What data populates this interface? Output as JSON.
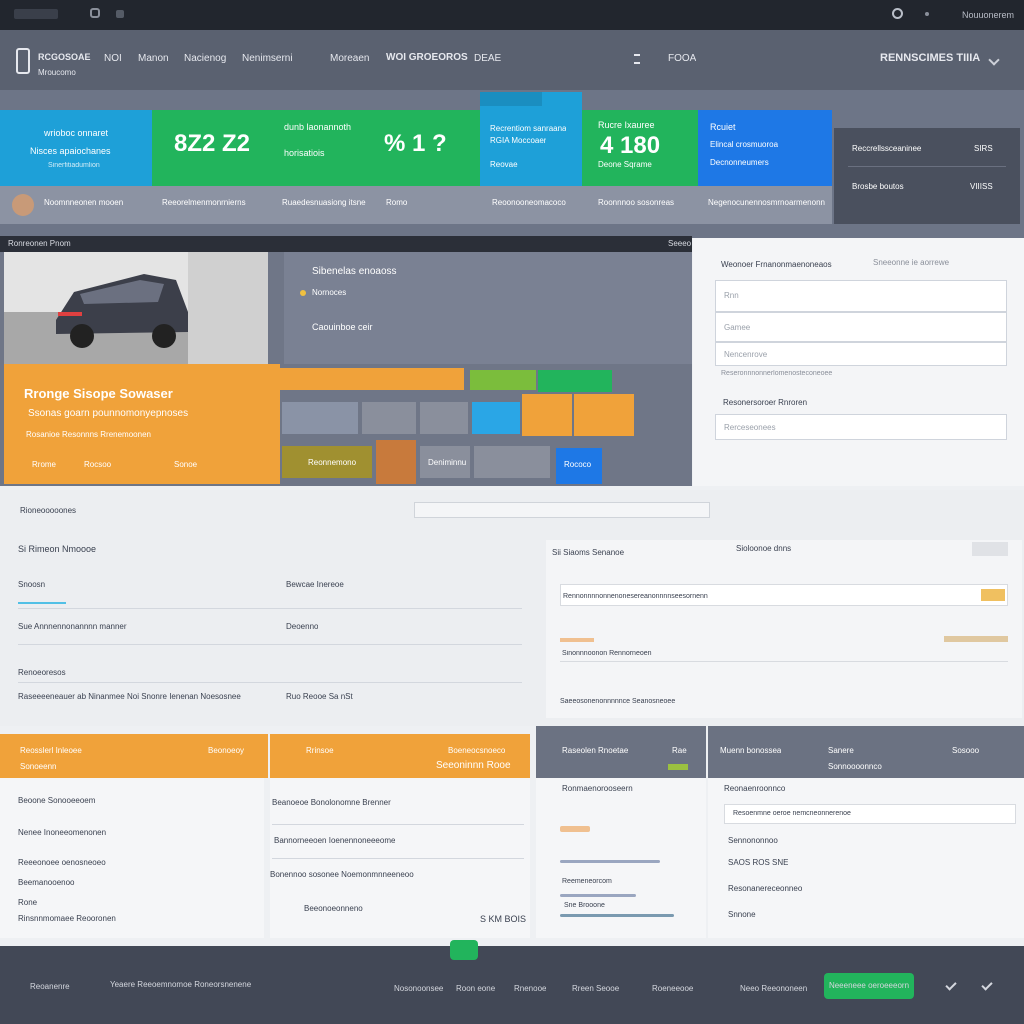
{
  "topbar": {
    "user": "Nouuonerem",
    "icons": [
      "search-icon",
      "notification-dot-icon"
    ]
  },
  "nav": {
    "brand_title": "RCGOSOAE",
    "brand_sub": "Mroucomo",
    "items": [
      "NOI",
      "Manon",
      "Nacienog",
      "Nenimserni",
      "Moreaen"
    ],
    "center_title": "WOI GROEOROS",
    "center_sub": "DEAE",
    "mid_item": "FOOA",
    "right_title": "RENNSCIMES TIIIA",
    "colors": {
      "bg": "#5a6170"
    }
  },
  "stats": [
    {
      "title": "wrioboc onnaret",
      "sub": "Nisces apaiochanes",
      "foot": "Sinerfitiadumlion",
      "color": "#1ea0d8"
    },
    {
      "value": "8Z2 Z2",
      "foot": "",
      "color": "#22b45c"
    },
    {
      "title": "dunb laonannoth",
      "sub": "horisatiois",
      "value": "%  1 ?",
      "color": "#22b45c"
    },
    {
      "title": "Recrentiom sanraana",
      "sub": "RGIA Moccoaer",
      "foot": "Reovae",
      "color": "#1ea0d8"
    },
    {
      "title": "Rucre Ixauree",
      "value": "4 180",
      "foot": "Deone  Sqrame",
      "color": "#22b45c"
    },
    {
      "title": "Rcuiet",
      "sub": "Elincal crosmuoroa",
      "foot": "Decnonneumers",
      "color": "#1e78e6"
    }
  ],
  "stats_side": [
    {
      "label": "Reccrellssceaninee",
      "value": "SIRS"
    },
    {
      "label": "Brosbe boutos",
      "value": "VIIISS"
    }
  ],
  "subrow": [
    "Noomnneonen mooen",
    "Reeorelmenmonrnierns",
    "Ruaedesnuasiong itsne",
    "Romo",
    "Reoonooneomacoco",
    "Roonnnoo sosonreas",
    "Negenocunennosmrnoarmenonn"
  ],
  "media": {
    "header": "Ronreonen Pnom",
    "header_right": "Seeeo",
    "panel_title": "Sibenelas enoaoss",
    "panel_sub": "Nornoces",
    "panel_badge": "Caouinboe ceir",
    "promo_title": "Rronge Sisope Sowaser",
    "promo_sub": "Ssonas goarn pounnomonyepnoses",
    "promo_meta": "Rosanioe Resonnns Rrenemoonen",
    "promo_buttons": [
      "Rrome",
      "Rocsoo",
      "Sonoe"
    ],
    "tiles": [
      "Reonnemono",
      "Deniminnu",
      "Rococo"
    ]
  },
  "rform": {
    "title": "Weonoer Frnanonmaenoneaos",
    "link": "Sneeonne ie aorrewe",
    "fields": [
      "Rnn",
      "Gamee",
      "Nencenrove",
      "Reseronnnonnerlomenosteconeoee"
    ],
    "label2": "Resonersoroer Rnroren",
    "field_last": "Rerceseonees"
  },
  "mid": {
    "title": "Rioneooooones",
    "left_heading": "Si Rimeon Nmoooe",
    "col1_head": "Snoosn",
    "col2_head": "Bewcae Inereoe",
    "rows_left": [
      "Sue Annnennonannnn manner",
      "Renoeoresos",
      "Raseeeeneauer ab Ninanmee  Noi Snonre Ienenan Noesosnee"
    ],
    "rows_left2": [
      "Deoenno",
      "Ruo Reooe Sa  nSt"
    ],
    "right_heading": "Sii  Siaoms Senanoe",
    "right_aside": "Sioloonoe dnns",
    "rows_right": [
      "Rennonnnnonnenonesereanonnnnseesornenn",
      "Sinonnnoonon Rennorneoen",
      "Saeeosonenonnnnnce Seanosneoee"
    ]
  },
  "panels": [
    {
      "title": "Reosslerl Inleoee",
      "aside": "Beonoeoy",
      "sub": "Sonoeenn",
      "rows": [
        "Beoone Sonooeeoem",
        "Nenee Inoneeomenonen",
        "Reeeonoee oenosneoeo",
        "Beemanooenoo",
        "Rone",
        "Rinsnnmomaee Reooronen"
      ]
    },
    {
      "title": "Rrinsoe",
      "aside": "Boeneocsnoeco",
      "aside2": "Seeoninnn Rooe",
      "rows": [
        "Beanoeoe Bonolonomne Brenner",
        "Bannorneeoen Ioenennoneeeome",
        "Bonennoo sosonee Noemonmnneeneoo",
        "Beeonoeonneno"
      ],
      "foot": "S KM BOIS"
    },
    {
      "title": "Raseolen Rnoetae",
      "aside": "Rae",
      "sub": "Ronmaenorooseern",
      "rows": [
        "Reemeneorcom",
        "Sne  Brooone",
        "Snooonenae"
      ]
    },
    {
      "title": "Muenn bonossea",
      "aside": "Sanere",
      "aside2": "Sosooo",
      "sub": "Sonnoooonnco",
      "rows": [
        "Reonaenroonnco",
        "Resoenmne oeroe nemcneonnerenoe",
        "Sennononnoo",
        "SAOS ROS SNE",
        "Resonanereceonneo",
        "Snnone"
      ]
    }
  ],
  "footer": {
    "items": [
      "Reoanenre",
      "Yeaere Reeoemnomoe Roneorsnenene",
      "Nosonoonsee",
      "Roon eone",
      "Rnenooe",
      "Rreen Seooe",
      "Roeneeooe",
      "Neeo Reeononeen"
    ],
    "cta": "Neeeneee oeroeeeorn",
    "icons": [
      "check-icon",
      "check-icon"
    ]
  }
}
